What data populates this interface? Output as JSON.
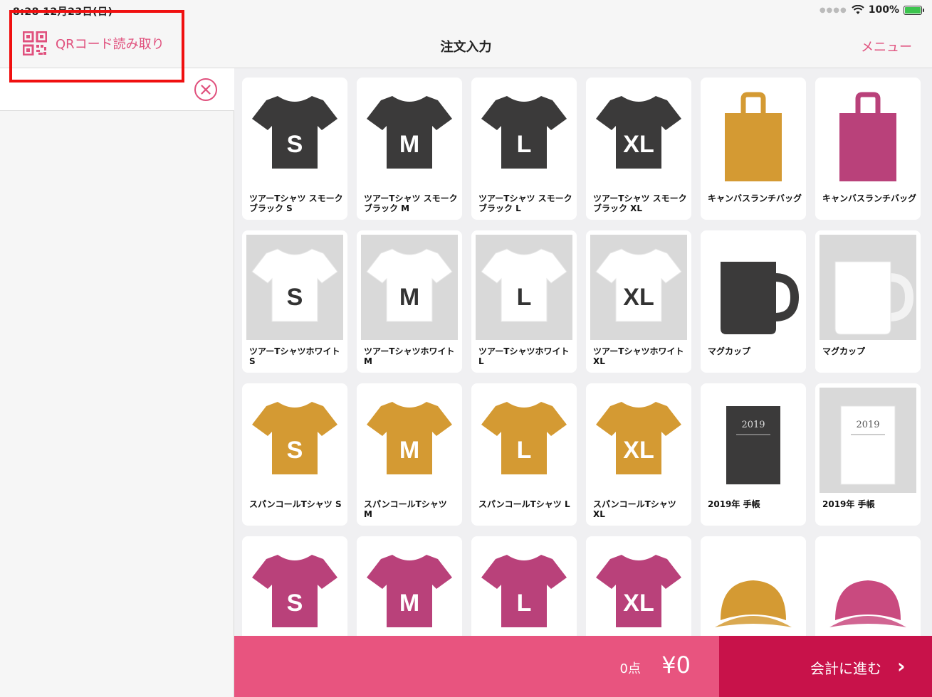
{
  "status_bar": {
    "time_text": "8:28  12月23日(日)",
    "battery_text": "100%",
    "icons": [
      "signal-dots-icon",
      "wifi-icon",
      "battery-charging-icon"
    ]
  },
  "nav": {
    "qr_label": "QRコード読み取り",
    "title": "注文入力",
    "menu_label": "メニュー"
  },
  "colors": {
    "accent": "#e0507d",
    "footer_summary": "#e8547f",
    "footer_checkout": "#c8124a",
    "smoke_black": "#3b3a3a",
    "gold": "#d49a33",
    "magenta": "#b9417a",
    "highlight": "#f01010"
  },
  "products": [
    {
      "name": "ツアーTシャツ スモークブラック S",
      "kind": "tshirt",
      "color": "#3b3a3a",
      "size": "S",
      "bg": "white"
    },
    {
      "name": "ツアーTシャツ スモークブラック M",
      "kind": "tshirt",
      "color": "#3b3a3a",
      "size": "M",
      "bg": "white"
    },
    {
      "name": "ツアーTシャツ スモークブラック L",
      "kind": "tshirt",
      "color": "#3b3a3a",
      "size": "L",
      "bg": "white"
    },
    {
      "name": "ツアーTシャツ スモークブラック XL",
      "kind": "tshirt",
      "color": "#3b3a3a",
      "size": "XL",
      "bg": "white"
    },
    {
      "name": "キャンバスランチバッグ",
      "kind": "bag",
      "color": "#d49a33",
      "bg": "white"
    },
    {
      "name": "キャンバスランチバッグ",
      "kind": "bag",
      "color": "#b9417a",
      "bg": "white"
    },
    {
      "name": "ツアーTシャツホワイト S",
      "kind": "tshirt",
      "color": "#ffffff",
      "size": "S",
      "bg": "gray"
    },
    {
      "name": "ツアーTシャツホワイト M",
      "kind": "tshirt",
      "color": "#ffffff",
      "size": "M",
      "bg": "gray"
    },
    {
      "name": "ツアーTシャツホワイト L",
      "kind": "tshirt",
      "color": "#ffffff",
      "size": "L",
      "bg": "gray"
    },
    {
      "name": "ツアーTシャツホワイト XL",
      "kind": "tshirt",
      "color": "#ffffff",
      "size": "XL",
      "bg": "gray"
    },
    {
      "name": "マグカップ",
      "kind": "mug",
      "color": "#3b3a3a",
      "bg": "white"
    },
    {
      "name": "マグカップ",
      "kind": "mug",
      "color": "#ffffff",
      "bg": "gray"
    },
    {
      "name": "スパンコールTシャツ S",
      "kind": "tshirt",
      "color": "#d49a33",
      "size": "S",
      "bg": "white"
    },
    {
      "name": "スパンコールTシャツ M",
      "kind": "tshirt",
      "color": "#d49a33",
      "size": "M",
      "bg": "white"
    },
    {
      "name": "スパンコールTシャツ L",
      "kind": "tshirt",
      "color": "#d49a33",
      "size": "L",
      "bg": "white"
    },
    {
      "name": "スパンコールTシャツ XL",
      "kind": "tshirt",
      "color": "#d49a33",
      "size": "XL",
      "bg": "white"
    },
    {
      "name": "2019年 手帳",
      "kind": "notebook",
      "color": "#3b3a3a",
      "cover_text": "2019",
      "bg": "white"
    },
    {
      "name": "2019年 手帳",
      "kind": "notebook",
      "color": "#ffffff",
      "cover_text": "2019",
      "bg": "gray"
    },
    {
      "name": "",
      "kind": "tshirt",
      "color": "#b9417a",
      "size": "S",
      "bg": "white"
    },
    {
      "name": "",
      "kind": "tshirt",
      "color": "#b9417a",
      "size": "M",
      "bg": "white"
    },
    {
      "name": "",
      "kind": "tshirt",
      "color": "#b9417a",
      "size": "L",
      "bg": "white"
    },
    {
      "name": "",
      "kind": "tshirt",
      "color": "#b9417a",
      "size": "XL",
      "bg": "white"
    },
    {
      "name": "",
      "kind": "cap",
      "color": "#d49a33",
      "bg": "white"
    },
    {
      "name": "",
      "kind": "cap",
      "color": "#c94a7f",
      "bg": "white"
    }
  ],
  "footer": {
    "count_text": "0点",
    "total_text": "¥0",
    "checkout_label": "会計に進む"
  }
}
